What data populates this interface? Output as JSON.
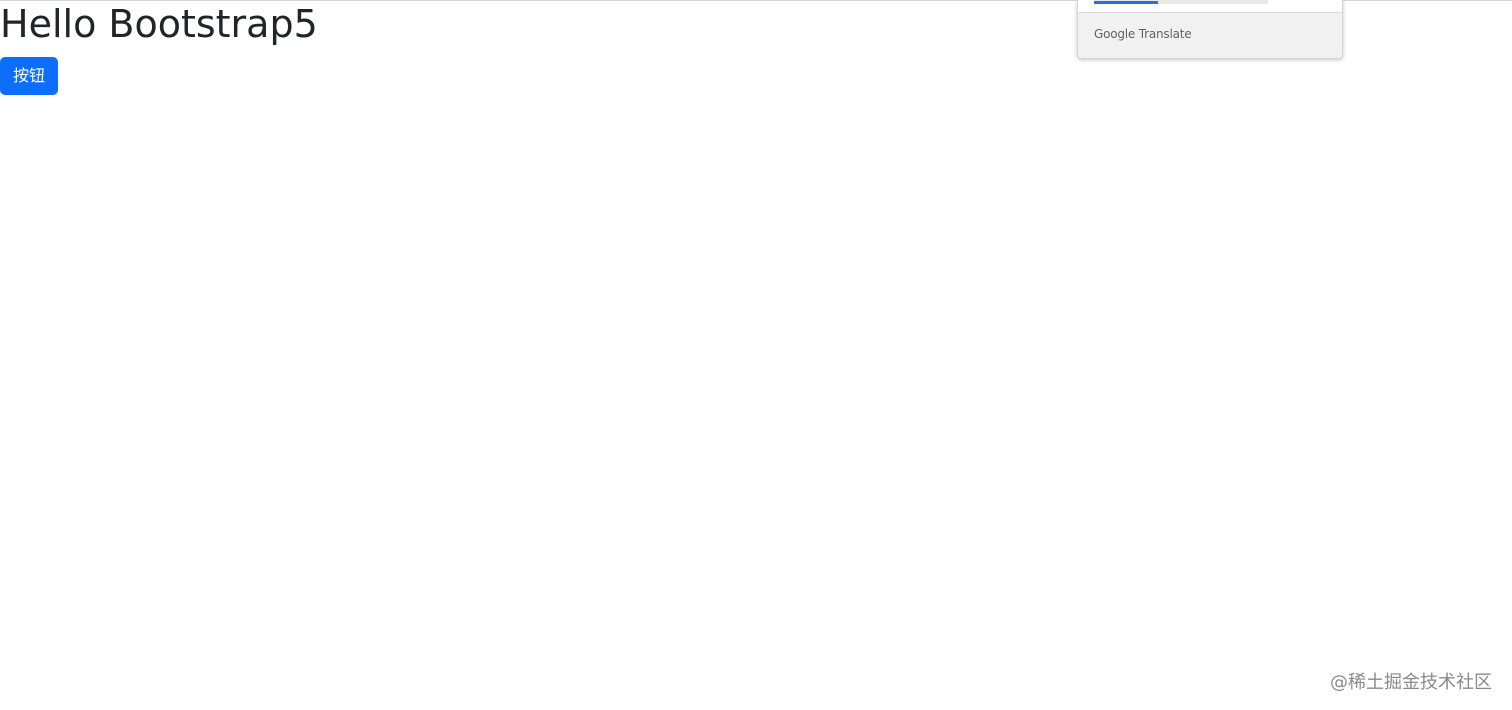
{
  "page": {
    "title": "Hello Bootstrap5",
    "button_label": "按钮"
  },
  "translate_popup": {
    "brand": "Google Translate"
  },
  "watermark": {
    "text": "@稀土掘金技术社区"
  },
  "colors": {
    "primary_button": "#0d6efd",
    "title_text": "#212529",
    "translate_accent": "#1a73e8"
  }
}
